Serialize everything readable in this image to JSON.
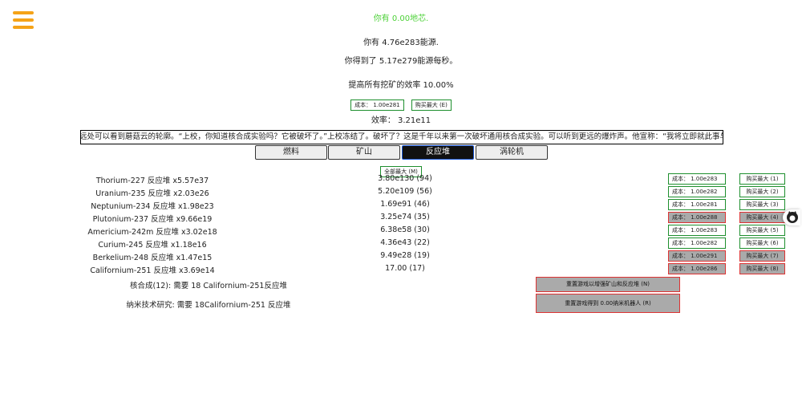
{
  "header": {
    "dark_matter": "你有 0.00地芯.",
    "energy": "你有 4.76e283能源.",
    "energy_rate": "你得到了 5.17e279能源每秒。",
    "mining_efficiency_label": "提高所有挖矿的效率 10.00%",
    "cost_button": "成本： 1.00e281",
    "buy_max_button": "购买最大 (E)",
    "efficiency": "效率： 3.21e11"
  },
  "story_text": "远处可以看到蘑菇云的轮廓。“上校，你知道核合成实验吗？它被破坏了。”上校冻结了。破坏了？这是千年以来第一次破坏通用核合成实验。可以听到更远的爆炸声。他宣称：“我将立即就此事与安理会商",
  "tabs": [
    {
      "label": "燃料",
      "active": false
    },
    {
      "label": "矿山",
      "active": false
    },
    {
      "label": "反应堆",
      "active": true
    },
    {
      "label": "涡轮机",
      "active": false
    }
  ],
  "buy_all_max": "全部最大 (M)",
  "reactors": [
    {
      "name": "Thorium-227 反应堆 x5.57e37",
      "amount": "3.80e130 (94)",
      "cost": "成本： 1.00e283",
      "max": "购买最大 (1)",
      "affordable": true
    },
    {
      "name": "Uranium-235 反应堆 x2.03e26",
      "amount": "5.20e109 (56)",
      "cost": "成本： 1.00e282",
      "max": "购买最大 (2)",
      "affordable": true
    },
    {
      "name": "Neptunium-234 反应堆 x1.98e23",
      "amount": "1.69e91 (46)",
      "cost": "成本： 1.00e281",
      "max": "购买最大 (3)",
      "affordable": true
    },
    {
      "name": "Plutonium-237 反应堆 x9.66e19",
      "amount": "3.25e74 (35)",
      "cost": "成本： 1.00e288",
      "max": "购买最大 (4)",
      "affordable": false
    },
    {
      "name": "Americium-242m 反应堆 x3.02e18",
      "amount": "6.38e58 (30)",
      "cost": "成本： 1.00e283",
      "max": "购买最大 (5)",
      "affordable": true
    },
    {
      "name": "Curium-245 反应堆 x1.18e16",
      "amount": "4.36e43 (22)",
      "cost": "成本： 1.00e282",
      "max": "购买最大 (6)",
      "affordable": true
    },
    {
      "name": "Berkelium-248 反应堆 x1.47e15",
      "amount": "9.49e28 (19)",
      "cost": "成本： 1.00e291",
      "max": "购买最大 (7)",
      "affordable": false
    },
    {
      "name": "Californium-251 反应堆 x3.69e14",
      "amount": "17.00 (17)",
      "cost": "成本： 1.00e286",
      "max": "购买最大 (8)",
      "affordable": false
    }
  ],
  "nucleosynthesis_label": "核合成(12): 需要 18 Californium-251反应堆",
  "nucleosynthesis_button": "重置游戏以增强矿山和反应堆 (N)",
  "nanotech_label": "纳米技术研究: 需要 18Californium-251 反应堆",
  "nanotech_button": "重置游戏得到 0.00纳米机器人 (R)",
  "colors": {
    "accent": "#f5a318",
    "green": "#1e8f2e",
    "red": "#d33333",
    "dark_matter_text": "#4cd137"
  }
}
